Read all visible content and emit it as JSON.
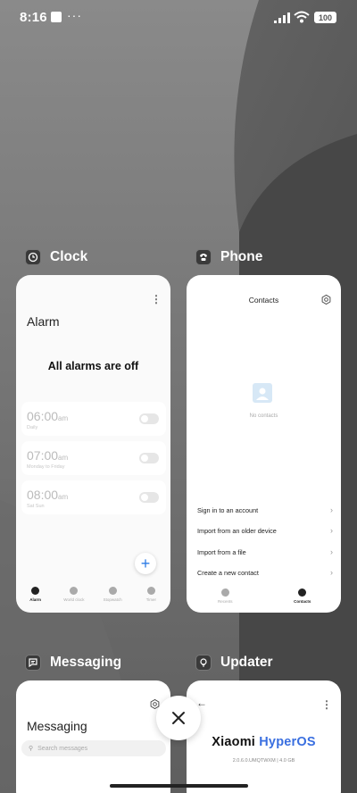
{
  "status_bar": {
    "time": "8:16",
    "more": "···",
    "battery": "100"
  },
  "apps": {
    "clock": {
      "name": "Clock",
      "screen": {
        "title": "Alarm",
        "empty_message": "All alarms are off",
        "alarms": [
          {
            "time": "06:00",
            "ampm": "am",
            "repeat": "Daily",
            "enabled": false
          },
          {
            "time": "07:00",
            "ampm": "am",
            "repeat": "Monday to Friday",
            "enabled": false
          },
          {
            "time": "08:00",
            "ampm": "am",
            "repeat": "Sat Sun",
            "enabled": false
          }
        ],
        "nav": [
          "Alarm",
          "World clock",
          "Stopwatch",
          "Timer"
        ]
      }
    },
    "phone": {
      "name": "Phone",
      "screen": {
        "title": "Contacts",
        "empty_message": "No contacts",
        "actions": [
          "Sign in to an account",
          "Import from an older device",
          "Import from a file",
          "Create a new contact"
        ],
        "nav": [
          "Recents",
          "Contacts"
        ]
      }
    },
    "messaging": {
      "name": "Messaging",
      "screen": {
        "title": "Messaging",
        "search_placeholder": "Search messages"
      }
    },
    "updater": {
      "name": "Updater",
      "screen": {
        "os_brand": "Xiaomi",
        "os_name": "HyperOS",
        "version": "2.0.6.0.UMQTWXM | 4.0 GB"
      }
    }
  },
  "colors": {
    "accent": "#2b7be5",
    "os_highlight": "#3a6fe0",
    "background": "#585858"
  }
}
